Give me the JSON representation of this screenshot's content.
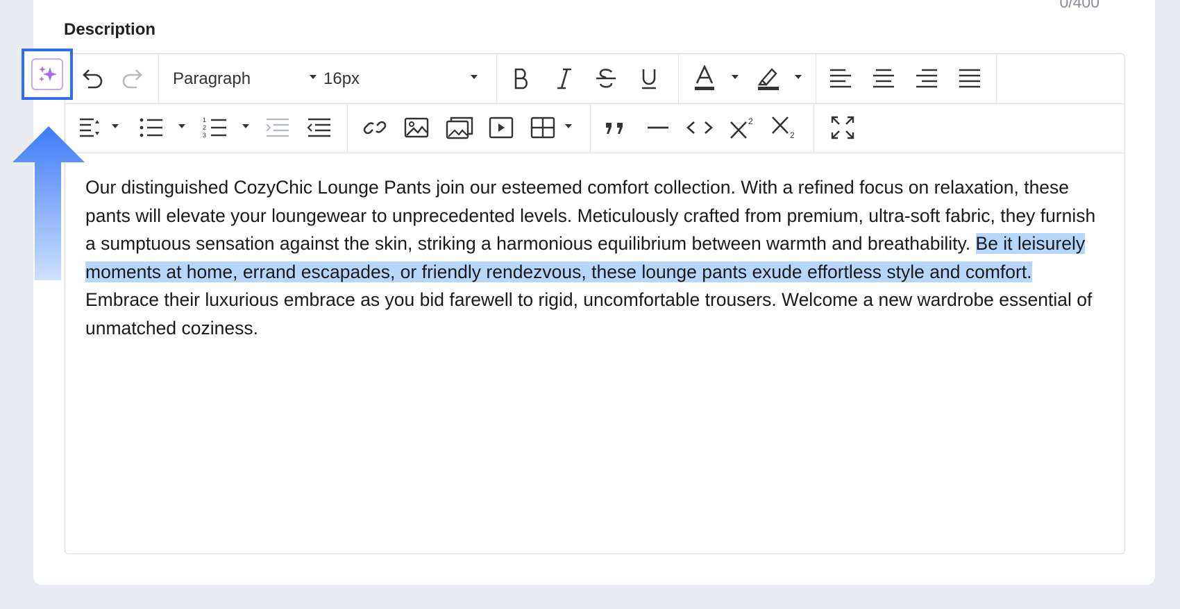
{
  "field": {
    "label": "Description",
    "counter": "0/400"
  },
  "toolbar": {
    "block_format": "Paragraph",
    "font_size": "16px"
  },
  "content": {
    "before": "Our distinguished CozyChic Lounge Pants join our esteemed comfort collection. With a refined focus on relaxation, these pants will elevate your loungewear to unprecedented levels. Meticulously crafted from premium, ultra-soft fabric, they furnish a sumptuous sensation against the skin, striking a harmonious equilibrium between warmth and breathability. ",
    "selected": "Be it leisurely moments at home, errand escapades, or friendly rendezvous, these lounge pants exude effortless style and comfort.",
    "after": " Embrace their luxurious embrace as you bid farewell to rigid, uncomfortable trousers. Welcome a new wardrobe essential of unmatched coziness."
  },
  "colors": {
    "highlight": "#b6d7fb",
    "annotation_blue": "#2f6df6",
    "ai_purple": "#a46af0"
  },
  "icons": [
    "ai-sparkle-icon",
    "undo-icon",
    "redo-icon",
    "bold-icon",
    "italic-icon",
    "strikethrough-icon",
    "underline-icon",
    "font-color-icon",
    "highlight-color-icon",
    "align-left-icon",
    "align-center-icon",
    "align-right-icon",
    "align-justify-icon",
    "line-height-icon",
    "bullet-list-icon",
    "numbered-list-icon",
    "indent-icon",
    "outdent-icon",
    "link-icon",
    "image-icon",
    "gallery-icon",
    "video-icon",
    "table-icon",
    "quote-icon",
    "horizontal-rule-icon",
    "code-icon",
    "superscript-icon",
    "subscript-icon",
    "fullscreen-icon",
    "up-arrow-icon"
  ]
}
